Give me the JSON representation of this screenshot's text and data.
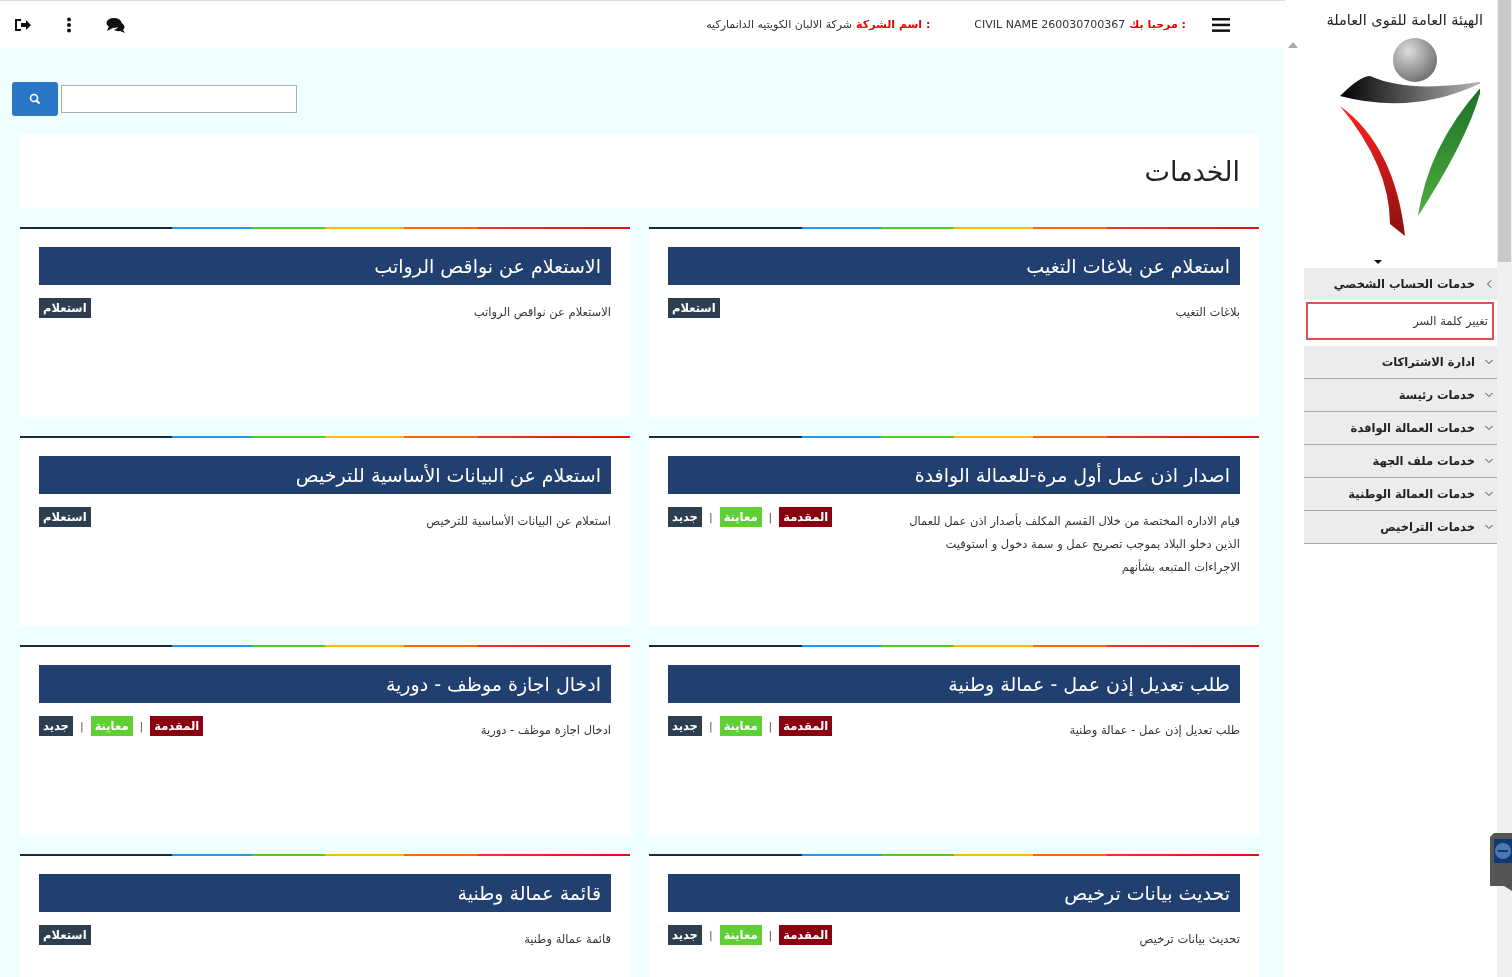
{
  "header": {
    "site_title": "الهيئة العامة للقوى العاملة",
    "welcome_label": "مرحبا بك :",
    "civil_name": "CIVIL NAME 260030700367",
    "company_label": "اسم الشركة :",
    "company_name": "شركة الالبان الكويتيه الدانماركيه"
  },
  "section_title": "الخدمات",
  "services": [
    {
      "title": "استعلام عن بلاغات التغيب",
      "description": [
        "بلاغات التغيب"
      ],
      "badges": [
        {
          "kind": "inquiry",
          "label": "استعلام"
        }
      ]
    },
    {
      "title": "الاستعلام عن نواقص الرواتب",
      "description": [
        "الاستعلام عن نواقص الرواتب"
      ],
      "badges": [
        {
          "kind": "inquiry",
          "label": "استعلام"
        }
      ]
    },
    {
      "title": "اصدار اذن عمل أول مرة-للعمالة الوافدة",
      "description": [
        "قيام الاداره المختصة من خلال القسم المكلف بأصدار اذن عمل للعمال",
        "الذين دخلو البلاد بموجب تصريح عمل و سمة دخول و استوفيت",
        "الاجراءات المتبعه بشأنهم"
      ],
      "badges": [
        {
          "kind": "submitted",
          "label": "المقدمة"
        },
        {
          "kind": "separator",
          "label": "|"
        },
        {
          "kind": "inspection",
          "label": "معاينة"
        },
        {
          "kind": "separator",
          "label": "|"
        },
        {
          "kind": "new",
          "label": "جديد"
        }
      ]
    },
    {
      "title": "استعلام عن البيانات الأساسية للترخيص",
      "description": [
        "استعلام عن البيانات الأساسية للترخيص"
      ],
      "badges": [
        {
          "kind": "inquiry",
          "label": "استعلام"
        }
      ]
    },
    {
      "title": "طلب تعديل إذن عمل - عمالة وطنية",
      "description": [
        "طلب تعديل إذن عمل - عمالة وطنية"
      ],
      "badges": [
        {
          "kind": "submitted",
          "label": "المقدمة"
        },
        {
          "kind": "separator",
          "label": "|"
        },
        {
          "kind": "inspection",
          "label": "معاينة"
        },
        {
          "kind": "separator",
          "label": "|"
        },
        {
          "kind": "new",
          "label": "جديد"
        }
      ]
    },
    {
      "title": "ادخال اجازة موظف - دورية",
      "description": [
        "ادخال اجازة موظف - دورية"
      ],
      "badges": [
        {
          "kind": "submitted",
          "label": "المقدمة"
        },
        {
          "kind": "separator",
          "label": "|"
        },
        {
          "kind": "inspection",
          "label": "معاينة"
        },
        {
          "kind": "separator",
          "label": "|"
        },
        {
          "kind": "new",
          "label": "جديد"
        }
      ]
    },
    {
      "title": "تحديث بيانات ترخيص",
      "description": [
        "تحديث بيانات ترخيص"
      ],
      "badges": [
        {
          "kind": "submitted",
          "label": "المقدمة"
        },
        {
          "kind": "separator",
          "label": "|"
        },
        {
          "kind": "inspection",
          "label": "معاينة"
        },
        {
          "kind": "separator",
          "label": "|"
        },
        {
          "kind": "new",
          "label": "جديد"
        }
      ]
    },
    {
      "title": "قائمة عمالة وطنية",
      "description": [
        "قائمة عمالة وطنية"
      ],
      "badges": [
        {
          "kind": "inquiry",
          "label": "استعلام"
        }
      ]
    }
  ],
  "sidebar": {
    "items": [
      {
        "label": "خدمات الحساب الشخصي",
        "expanded": true,
        "children": [
          {
            "label": "تغيير كلمة السر",
            "selected": true
          }
        ]
      },
      {
        "label": "ادارة الاشتراكات",
        "expanded": false
      },
      {
        "label": "خدمات رئيسة",
        "expanded": false
      },
      {
        "label": "خدمات العمالة الوافدة",
        "expanded": false
      },
      {
        "label": "خدمات ملف الجهة",
        "expanded": false
      },
      {
        "label": "خدمات العمالة الوطنية",
        "expanded": false
      },
      {
        "label": "خدمات التراخيص",
        "expanded": false
      }
    ]
  }
}
